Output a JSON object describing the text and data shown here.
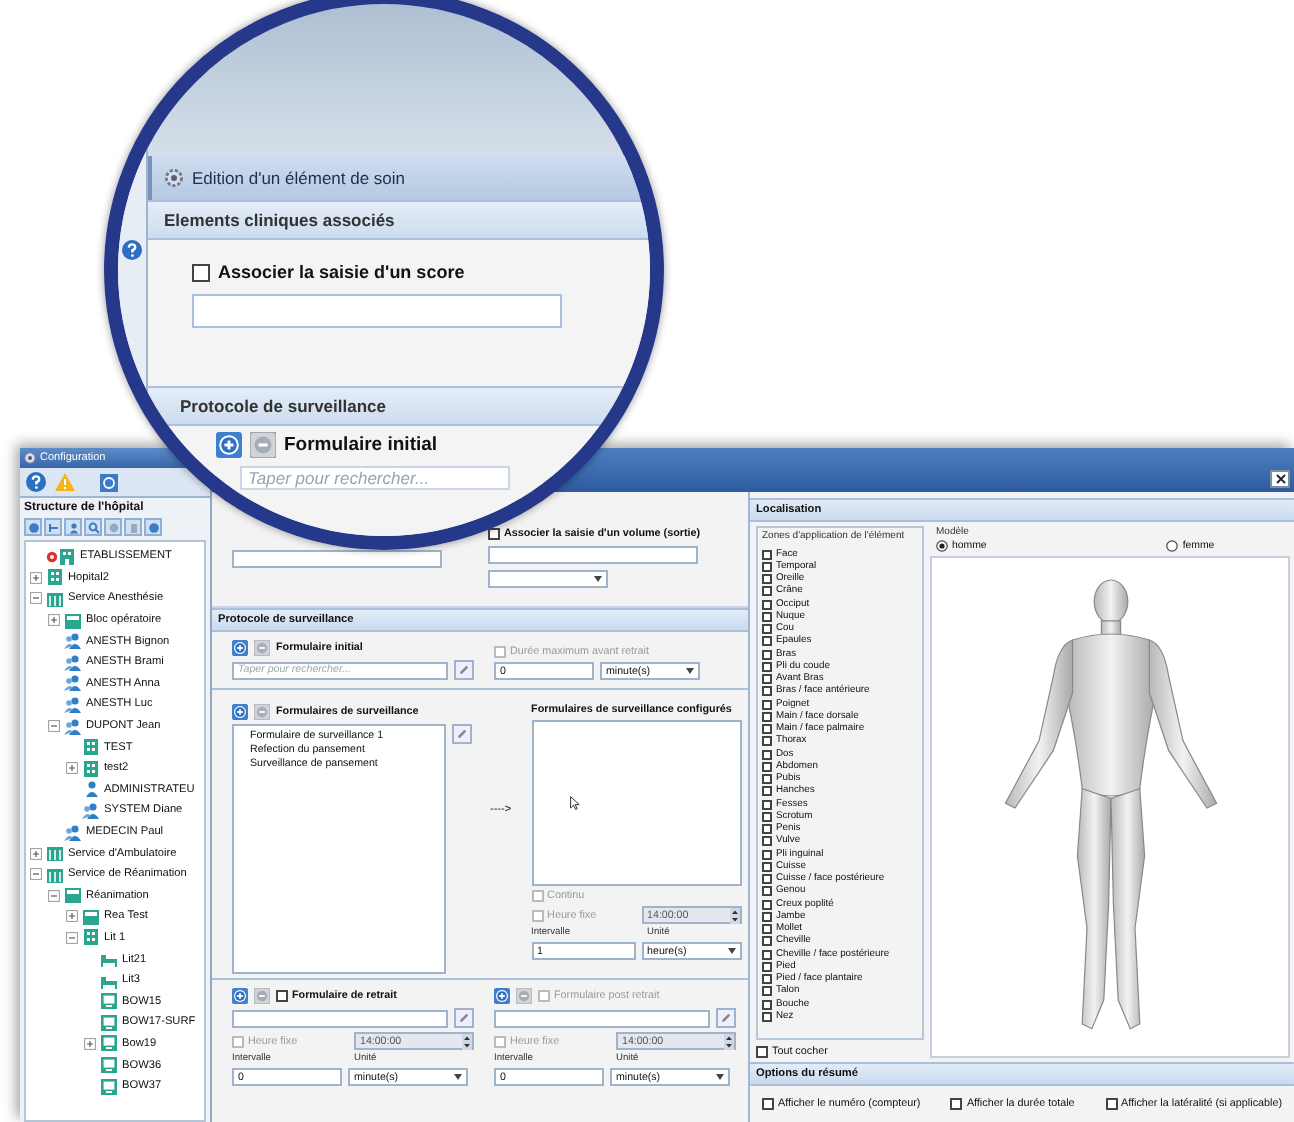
{
  "magnifier": {
    "dialog_title": "Edition d'un élément de soin",
    "clinical_section": "Elements cliniques associés",
    "score_checkbox": {
      "label": "Associer la saisie d'un score",
      "checked": false
    },
    "protocol_section": "Protocole de surveillance",
    "form_label": "Formulaire initial",
    "search_placeholder": "Taper pour rechercher..."
  },
  "window": {
    "title": "Configuration"
  },
  "sidebar": {
    "title": "Structure de l'hôpital",
    "tree": [
      {
        "label": "ETABLISSEMENT",
        "kind": "root",
        "expandable": false,
        "expanded": false
      },
      {
        "label": "Hopital2",
        "kind": "building",
        "expandable": true,
        "expanded": false
      },
      {
        "label": "Service Anesthésie",
        "kind": "service",
        "expandable": true,
        "expanded": true,
        "children": [
          {
            "label": "Bloc opératoire",
            "kind": "unit",
            "expandable": true,
            "expanded": false
          },
          {
            "label": "ANESTH Bignon",
            "kind": "person",
            "expandable": false,
            "expanded": false
          },
          {
            "label": "ANESTH Brami",
            "kind": "person",
            "expandable": false,
            "expanded": false
          },
          {
            "label": "ANESTH Anna",
            "kind": "person",
            "expandable": false,
            "expanded": false
          },
          {
            "label": "ANESTH Luc",
            "kind": "person",
            "expandable": false,
            "expanded": false
          },
          {
            "label": "DUPONT Jean",
            "kind": "person",
            "expandable": true,
            "expanded": true,
            "children": [
              {
                "label": "TEST",
                "kind": "building",
                "expandable": false,
                "expanded": false
              },
              {
                "label": "test2",
                "kind": "building",
                "expandable": true,
                "expanded": false
              },
              {
                "label": "ADMINISTRATEU",
                "kind": "admin",
                "expandable": false,
                "expanded": false
              },
              {
                "label": "SYSTEM Diane",
                "kind": "person",
                "expandable": false,
                "expanded": false
              }
            ]
          },
          {
            "label": "MEDECIN Paul",
            "kind": "person",
            "expandable": false,
            "expanded": false
          }
        ]
      },
      {
        "label": "Service d'Ambulatoire",
        "kind": "service",
        "expandable": true,
        "expanded": false
      },
      {
        "label": "Service de Réanimation",
        "kind": "service",
        "expandable": true,
        "expanded": true,
        "children": [
          {
            "label": "Réanimation",
            "kind": "unit",
            "expandable": true,
            "expanded": true,
            "children": [
              {
                "label": "Rea Test",
                "kind": "unit",
                "expandable": true,
                "expanded": false
              },
              {
                "label": "Lit 1",
                "kind": "building",
                "expandable": true,
                "expanded": true,
                "children": [
                  {
                    "label": "Lit21",
                    "kind": "bed",
                    "expandable": false,
                    "expanded": false
                  },
                  {
                    "label": "Lit3",
                    "kind": "bed",
                    "expandable": false,
                    "expanded": false
                  },
                  {
                    "label": "BOW15",
                    "kind": "monitor",
                    "expandable": false,
                    "expanded": false
                  },
                  {
                    "label": "BOW17-SURF",
                    "kind": "monitor",
                    "expandable": false,
                    "expanded": false
                  },
                  {
                    "label": "Bow19",
                    "kind": "monitor",
                    "expandable": true,
                    "expanded": false
                  },
                  {
                    "label": "BOW36",
                    "kind": "monitor",
                    "expandable": false,
                    "expanded": false
                  },
                  {
                    "label": "BOW37",
                    "kind": "monitor",
                    "expandable": false,
                    "expanded": false
                  }
                ]
              }
            ]
          }
        ]
      }
    ]
  },
  "dialog": {
    "volume_checkbox": {
      "label": "Associer la saisie d'un volume (sortie)",
      "checked": false
    },
    "protocol": {
      "title": "Protocole de surveillance",
      "initial": {
        "label": "Formulaire initial",
        "placeholder": "Taper pour rechercher...",
        "max_duration": {
          "label": "Durée maximum avant retrait",
          "checked": false,
          "disabled": true
        },
        "value": "0",
        "unit": "minute(s)"
      },
      "surveillance": {
        "label": "Formulaires de surveillance",
        "items": [
          "Formulaire de surveillance 1",
          "Refection du pansement",
          "Surveillance de pansement"
        ],
        "arrow": "---->",
        "configured_title": "Formulaires de surveillance configurés",
        "continuous": {
          "label": "Continu",
          "checked": false,
          "disabled": true
        },
        "fixed_time": {
          "label": "Heure fixe",
          "checked": false,
          "disabled": true
        },
        "time": "14:00:00",
        "interval_label": "Intervalle",
        "unit_label": "Unité",
        "interval": "1",
        "unit": "heure(s)"
      },
      "withdrawal": [
        {
          "label": "Formulaire de retrait",
          "checked": false,
          "disabled": false,
          "fixed_time": {
            "label": "Heure fixe",
            "checked": false,
            "disabled": true
          },
          "time": "14:00:00",
          "interval_label": "Intervalle",
          "unit_label": "Unité",
          "interval": "0",
          "unit": "minute(s)"
        },
        {
          "label": "Formulaire post retrait",
          "checked": false,
          "disabled": true,
          "fixed_time": {
            "label": "Heure fixe",
            "checked": false,
            "disabled": true
          },
          "time": "14:00:00",
          "interval_label": "Intervalle",
          "unit_label": "Unité",
          "interval": "0",
          "unit": "minute(s)"
        }
      ]
    },
    "localisation": {
      "title": "Localisation",
      "zones_legend": "Zones d'application de l'élément",
      "zones": [
        {
          "label": "Face",
          "checked": false
        },
        {
          "label": "Temporal",
          "checked": false
        },
        {
          "label": "Oreille",
          "checked": false
        },
        {
          "label": "Crâne",
          "checked": false
        },
        {
          "label": "Occiput",
          "checked": false
        },
        {
          "label": "Nuque",
          "checked": false
        },
        {
          "label": "Cou",
          "checked": false
        },
        {
          "label": "Epaules",
          "checked": false
        },
        {
          "label": "Bras",
          "checked": false
        },
        {
          "label": "Pli du coude",
          "checked": false
        },
        {
          "label": "Avant Bras",
          "checked": false
        },
        {
          "label": "Bras / face antérieure",
          "checked": false
        },
        {
          "label": "Poignet",
          "checked": false
        },
        {
          "label": "Main / face dorsale",
          "checked": false
        },
        {
          "label": "Main / face palmaire",
          "checked": false
        },
        {
          "label": "Thorax",
          "checked": false
        },
        {
          "label": "Dos",
          "checked": false
        },
        {
          "label": "Abdomen",
          "checked": false
        },
        {
          "label": "Pubis",
          "checked": false
        },
        {
          "label": "Hanches",
          "checked": false
        },
        {
          "label": "Fesses",
          "checked": false
        },
        {
          "label": "Scrotum",
          "checked": false
        },
        {
          "label": "Penis",
          "checked": false
        },
        {
          "label": "Vulve",
          "checked": false
        },
        {
          "label": "Pli inguinal",
          "checked": false
        },
        {
          "label": "Cuisse",
          "checked": false
        },
        {
          "label": "Cuisse / face postérieure",
          "checked": false
        },
        {
          "label": "Genou",
          "checked": false
        },
        {
          "label": "Creux poplité",
          "checked": false
        },
        {
          "label": "Jambe",
          "checked": false
        },
        {
          "label": "Mollet",
          "checked": false
        },
        {
          "label": "Cheville",
          "checked": false
        },
        {
          "label": "Cheville / face postérieure",
          "checked": false
        },
        {
          "label": "Pied",
          "checked": false
        },
        {
          "label": "Pied / face plantaire",
          "checked": false
        },
        {
          "label": "Talon",
          "checked": false
        },
        {
          "label": "Bouche",
          "checked": false
        },
        {
          "label": "Nez",
          "checked": false
        }
      ],
      "check_all": {
        "label": "Tout cocher",
        "checked": false
      },
      "model_legend": "Modèle",
      "models": [
        {
          "label": "homme",
          "selected": true
        },
        {
          "label": "femme",
          "selected": false
        }
      ]
    },
    "summary": {
      "title": "Options du résumé",
      "options": [
        {
          "label": "Afficher le numéro (compteur)",
          "checked": false
        },
        {
          "label": "Afficher la durée totale",
          "checked": false
        },
        {
          "label": "Afficher la latéralité (si applicable)",
          "checked": false
        }
      ]
    }
  }
}
